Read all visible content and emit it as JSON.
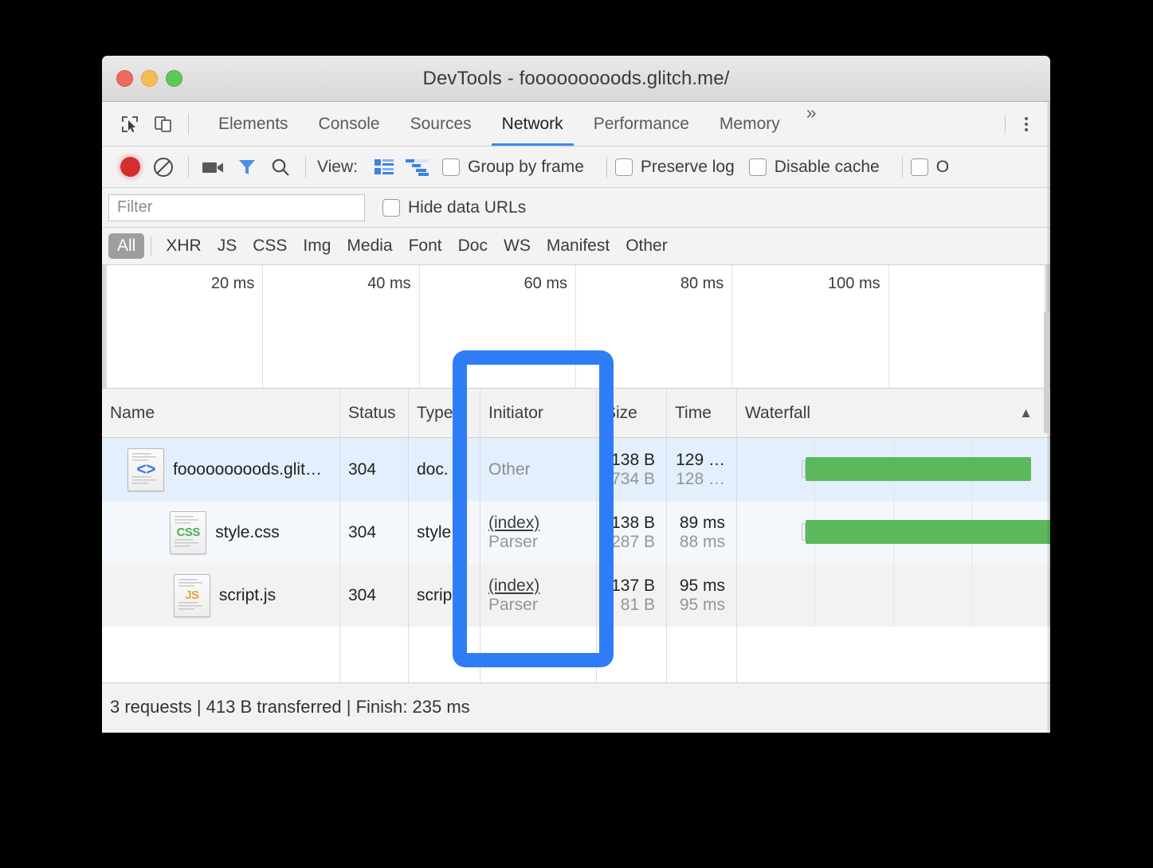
{
  "window": {
    "title": "DevTools - fooooooooods.glitch.me/",
    "traffic_lights": [
      "close",
      "minimize",
      "zoom"
    ]
  },
  "tabs": [
    {
      "label": "Elements",
      "active": false
    },
    {
      "label": "Console",
      "active": false
    },
    {
      "label": "Sources",
      "active": false
    },
    {
      "label": "Network",
      "active": true
    },
    {
      "label": "Performance",
      "active": false
    },
    {
      "label": "Memory",
      "active": false
    }
  ],
  "tabbar": {
    "overflow_label": "»",
    "inspect_icon": "inspect-element-icon",
    "device_icon": "device-toolbar-icon",
    "menu_icon": "kebab-menu-icon"
  },
  "toolbar": {
    "record_icon": "record-button",
    "clear_icon": "clear-icon",
    "camera_icon": "screenshot-camera-icon",
    "filter_icon": "filter-funnel-icon",
    "search_icon": "search-icon",
    "view_label": "View:",
    "view_list_icon": "list-view-icon",
    "view_waterfall_icon": "waterfall-view-icon",
    "checkboxes": [
      {
        "label": "Group by frame",
        "checked": false
      },
      {
        "label": "Preserve log",
        "checked": false
      },
      {
        "label": "Disable cache",
        "checked": false
      },
      {
        "label": "O",
        "checked": false
      }
    ]
  },
  "filterbar": {
    "filter_placeholder": "Filter",
    "filter_value": "",
    "hide_data_urls_label": "Hide data URLs",
    "hide_data_urls_checked": false
  },
  "type_filters": [
    {
      "label": "All",
      "active": true
    },
    {
      "label": "XHR",
      "active": false
    },
    {
      "label": "JS",
      "active": false
    },
    {
      "label": "CSS",
      "active": false
    },
    {
      "label": "Img",
      "active": false
    },
    {
      "label": "Media",
      "active": false
    },
    {
      "label": "Font",
      "active": false
    },
    {
      "label": "Doc",
      "active": false
    },
    {
      "label": "WS",
      "active": false
    },
    {
      "label": "Manifest",
      "active": false
    },
    {
      "label": "Other",
      "active": false
    }
  ],
  "overview": {
    "ticks": [
      "20 ms",
      "40 ms",
      "60 ms",
      "80 ms",
      "100 ms"
    ]
  },
  "table": {
    "columns": [
      "Name",
      "Status",
      "Type",
      "Initiator",
      "Size",
      "Time",
      "Waterfall"
    ],
    "sort_indicator": "▲",
    "rows": [
      {
        "icon": "html-document-icon",
        "icon_text": "<>",
        "name": "fooooooooods.glit…",
        "status": "304",
        "type": "doc.",
        "initiator_primary": "Other",
        "initiator_secondary": "",
        "size": "138 B",
        "size_sub": "734 B",
        "time": "129 …",
        "time_sub": "128 …",
        "selected": true,
        "bar_left_pct": 22,
        "bar_width_pct": 72
      },
      {
        "icon": "css-document-icon",
        "icon_text": "CSS",
        "name": "style.css",
        "status": "304",
        "type": "style…",
        "initiator_primary": "(index)",
        "initiator_secondary": "Parser",
        "size": "138 B",
        "size_sub": "287 B",
        "time": "89 ms",
        "time_sub": "88 ms",
        "selected": false,
        "bar_left_pct": 22,
        "bar_width_pct": 79
      },
      {
        "icon": "js-document-icon",
        "icon_text": "JS",
        "name": "script.js",
        "status": "304",
        "type": "scrip…",
        "initiator_primary": "(index)",
        "initiator_secondary": "Parser",
        "size": "137 B",
        "size_sub": "81 B",
        "time": "95 ms",
        "time_sub": "95 ms",
        "selected": false,
        "bar_left_pct": 0,
        "bar_width_pct": 0
      }
    ]
  },
  "statusbar": {
    "summary": "3 requests | 413 B transferred | Finish: 235 ms"
  },
  "annotation": {
    "target_column": "Initiator",
    "color": "#2f7df6"
  },
  "colors": {
    "accent": "#4285f4",
    "annotation": "#2f7df6",
    "waterfall_bar": "#5cb85c",
    "record": "#d32f2f",
    "selected_row": "#e3effc"
  }
}
